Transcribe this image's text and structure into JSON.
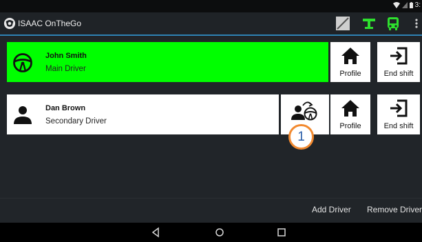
{
  "status_bar": {
    "time": "3:"
  },
  "app": {
    "title": "ISAAC OnTheGo"
  },
  "drivers": [
    {
      "name": "John Smith",
      "role": "Main Driver",
      "icon": "steering-wheel-icon",
      "color": "#00ff00"
    },
    {
      "name": "Dan Brown",
      "role": "Secondary Driver",
      "icon": "person-icon",
      "color": "#ffffff"
    }
  ],
  "buttons": {
    "profile": "Profile",
    "end_shift": "End shift",
    "add_driver": "Add Driver",
    "remove_driver": "Remove Driver"
  },
  "badge": {
    "number": "1"
  },
  "colors": {
    "accent_line": "#2f83b6",
    "active_green": "#00ff00",
    "badge_border": "#f28a30"
  }
}
